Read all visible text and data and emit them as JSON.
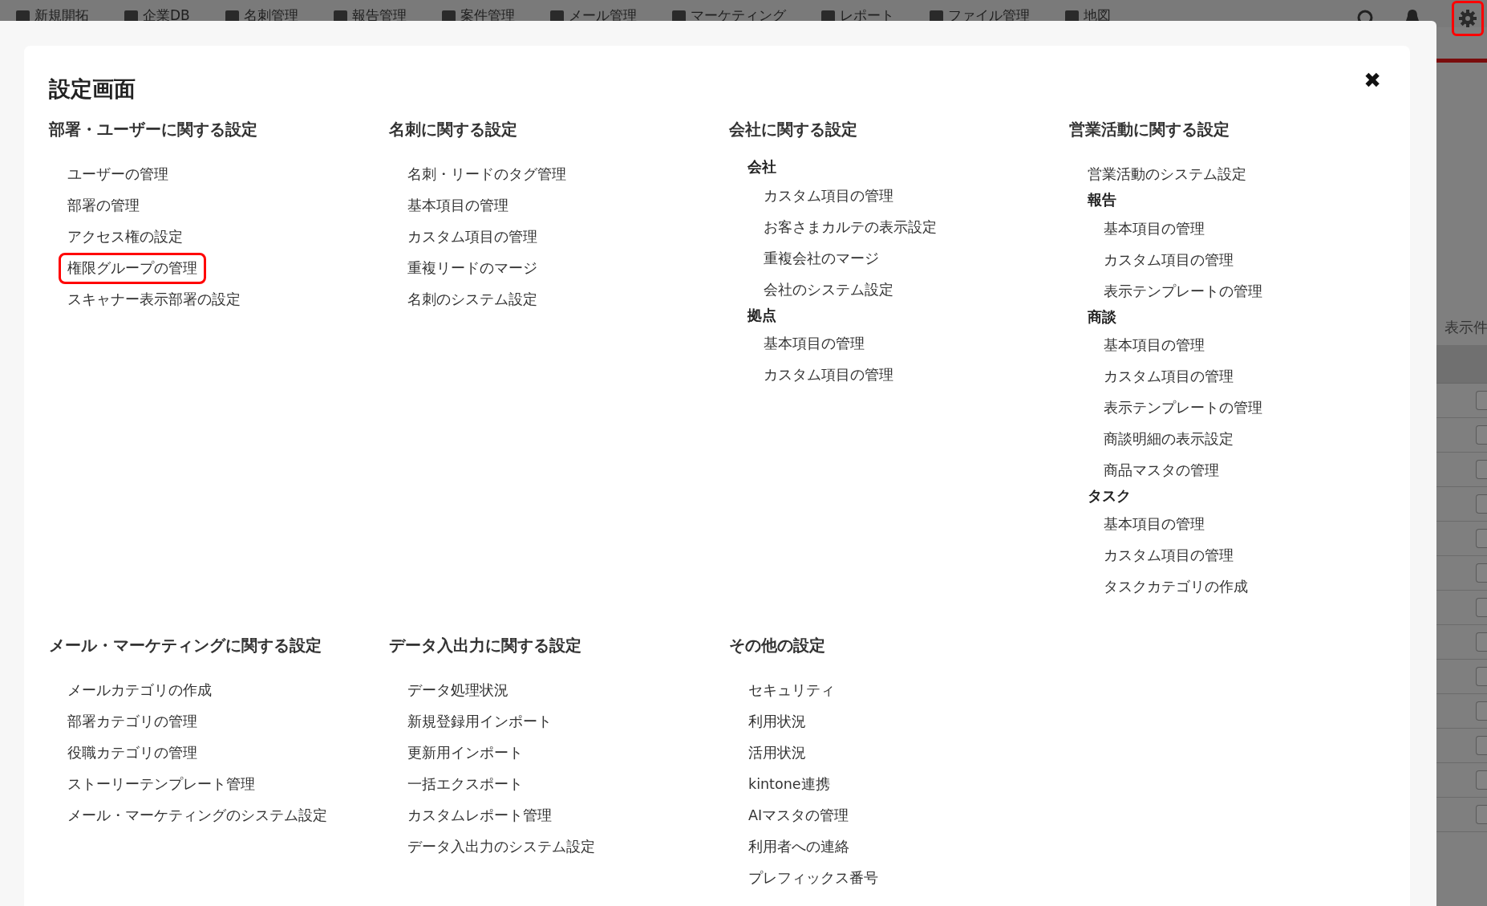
{
  "top_bar": {
    "menu": [
      "新規開拓",
      "企業DB",
      "名刺管理",
      "報告管理",
      "案件管理",
      "メール管理",
      "マーケティング",
      "レポート",
      "ファイル管理",
      "地図"
    ],
    "settings_highlighted": true
  },
  "page": {
    "text": "表示件"
  },
  "modal": {
    "title": "設定画面",
    "close": "✖",
    "sections": [
      {
        "title": "部署・ユーザーに関する設定",
        "items": [
          {
            "kind": "link",
            "label": "ユーザーの管理",
            "highlighted": false
          },
          {
            "kind": "link",
            "label": "部署の管理",
            "highlighted": false
          },
          {
            "kind": "link",
            "label": "アクセス権の設定",
            "highlighted": false
          },
          {
            "kind": "link",
            "label": "権限グループの管理",
            "highlighted": true
          },
          {
            "kind": "link",
            "label": "スキャナー表示部署の設定",
            "highlighted": false
          }
        ]
      },
      {
        "title": "名刺に関する設定",
        "items": [
          {
            "kind": "link",
            "label": "名刺・リードのタグ管理",
            "highlighted": false
          },
          {
            "kind": "link",
            "label": "基本項目の管理",
            "highlighted": false
          },
          {
            "kind": "link",
            "label": "カスタム項目の管理",
            "highlighted": false
          },
          {
            "kind": "link",
            "label": "重複リードのマージ",
            "highlighted": false
          },
          {
            "kind": "link",
            "label": "名刺のシステム設定",
            "highlighted": false
          }
        ]
      },
      {
        "title": "会社に関する設定",
        "items": [
          {
            "kind": "group",
            "label": "会社",
            "children": [
              {
                "kind": "link",
                "label": "カスタム項目の管理",
                "highlighted": false
              },
              {
                "kind": "link",
                "label": "お客さまカルテの表示設定",
                "highlighted": false
              },
              {
                "kind": "link",
                "label": "重複会社のマージ",
                "highlighted": false
              },
              {
                "kind": "link",
                "label": "会社のシステム設定",
                "highlighted": false
              }
            ]
          },
          {
            "kind": "group",
            "label": "拠点",
            "children": [
              {
                "kind": "link",
                "label": "基本項目の管理",
                "highlighted": false
              },
              {
                "kind": "link",
                "label": "カスタム項目の管理",
                "highlighted": false
              }
            ]
          }
        ]
      },
      {
        "title": "営業活動に関する設定",
        "items": [
          {
            "kind": "link",
            "label": "営業活動のシステム設定",
            "highlighted": false
          },
          {
            "kind": "group",
            "label": "報告",
            "children": [
              {
                "kind": "link",
                "label": "基本項目の管理",
                "highlighted": false
              },
              {
                "kind": "link",
                "label": "カスタム項目の管理",
                "highlighted": false
              },
              {
                "kind": "link",
                "label": "表示テンプレートの管理",
                "highlighted": false
              }
            ]
          },
          {
            "kind": "group",
            "label": "商談",
            "children": [
              {
                "kind": "link",
                "label": "基本項目の管理",
                "highlighted": false
              },
              {
                "kind": "link",
                "label": "カスタム項目の管理",
                "highlighted": false
              },
              {
                "kind": "link",
                "label": "表示テンプレートの管理",
                "highlighted": false
              },
              {
                "kind": "link",
                "label": "商談明細の表示設定",
                "highlighted": false
              },
              {
                "kind": "link",
                "label": "商品マスタの管理",
                "highlighted": false
              }
            ]
          },
          {
            "kind": "group",
            "label": "タスク",
            "children": [
              {
                "kind": "link",
                "label": "基本項目の管理",
                "highlighted": false
              },
              {
                "kind": "link",
                "label": "カスタム項目の管理",
                "highlighted": false
              },
              {
                "kind": "link",
                "label": "タスクカテゴリの作成",
                "highlighted": false
              }
            ]
          }
        ]
      },
      {
        "title": "メール・マーケティングに関する設定",
        "items": [
          {
            "kind": "link",
            "label": "メールカテゴリの作成",
            "highlighted": false
          },
          {
            "kind": "link",
            "label": "部署カテゴリの管理",
            "highlighted": false
          },
          {
            "kind": "link",
            "label": "役職カテゴリの管理",
            "highlighted": false
          },
          {
            "kind": "link",
            "label": "ストーリーテンプレート管理",
            "highlighted": false
          },
          {
            "kind": "link",
            "label": "メール・マーケティングのシステム設定",
            "highlighted": false
          }
        ]
      },
      {
        "title": "データ入出力に関する設定",
        "items": [
          {
            "kind": "link",
            "label": "データ処理状況",
            "highlighted": false
          },
          {
            "kind": "link",
            "label": "新規登録用インポート",
            "highlighted": false
          },
          {
            "kind": "link",
            "label": "更新用インポート",
            "highlighted": false
          },
          {
            "kind": "link",
            "label": "一括エクスポート",
            "highlighted": false
          },
          {
            "kind": "link",
            "label": "カスタムレポート管理",
            "highlighted": false
          },
          {
            "kind": "link",
            "label": "データ入出力のシステム設定",
            "highlighted": false
          }
        ]
      },
      {
        "title": "その他の設定",
        "items": [
          {
            "kind": "plain",
            "label": "セキュリティ",
            "highlighted": false
          },
          {
            "kind": "plain",
            "label": "利用状況",
            "highlighted": false
          },
          {
            "kind": "plain",
            "label": "活用状況",
            "highlighted": false
          },
          {
            "kind": "plain",
            "label": "kintone連携",
            "highlighted": false
          },
          {
            "kind": "plain",
            "label": "AIマスタの管理",
            "highlighted": false
          },
          {
            "kind": "plain",
            "label": "利用者への連絡",
            "highlighted": false
          },
          {
            "kind": "plain",
            "label": "プレフィックス番号",
            "highlighted": false
          }
        ]
      }
    ]
  }
}
